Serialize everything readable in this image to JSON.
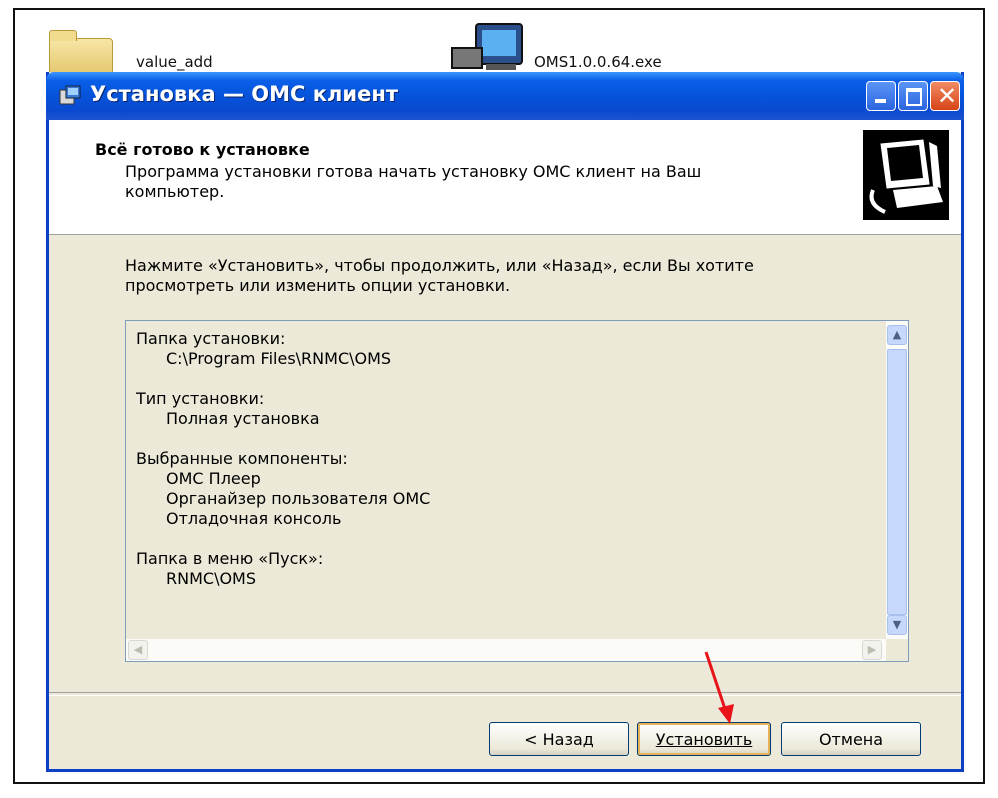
{
  "desktop": {
    "folder_label": "value_add",
    "exe_label": "OMS1.0.0.64.exe"
  },
  "window": {
    "title": "Установка — ОМС клиент",
    "icon": "installer-icon",
    "controls": {
      "minimize": "minimize-icon",
      "maximize": "maximize-icon",
      "close": "close-icon"
    }
  },
  "header": {
    "title": "Всё готово к установке",
    "subtitle": "Программа установки готова начать установку ОМС клиент на Ваш компьютер."
  },
  "body": {
    "intro": "Нажмите «Установить», чтобы продолжить, или «Назад», если Вы хотите просмотреть или изменить опции установки.",
    "summary": {
      "install_folder_label": "Папка установки:",
      "install_folder_value": "C:\\Program Files\\RNMC\\OMS",
      "setup_type_label": "Тип установки:",
      "setup_type_value": "Полная установка",
      "components_label": "Выбранные компоненты:",
      "components": [
        "ОМС Плеер",
        "Органайзер пользователя ОМС",
        "Отладочная консоль"
      ],
      "start_menu_label": "Папка в меню «Пуск»:",
      "start_menu_value": "RNMC\\OMS"
    }
  },
  "buttons": {
    "back": "< Назад",
    "install": "Установить",
    "cancel": "Отмена"
  },
  "colors": {
    "titlebar": "#0553da",
    "window_bg": "#ece9d8",
    "annotation_arrow": "#e8141a"
  }
}
